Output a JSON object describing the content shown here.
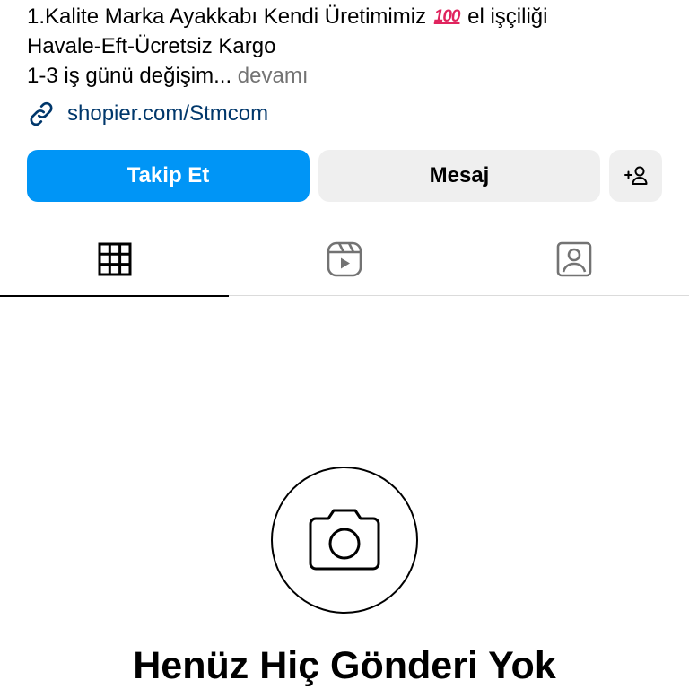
{
  "bio": {
    "line1_before": "1.Kalite Marka Ayakkabı Kendi Üretimimiz",
    "line1_emoji": "100",
    "line1_after": "el işçiliği",
    "line2": "Havale-Eft-Ücretsiz Kargo",
    "line3": "1-3 iş günü değişim...",
    "more": "devamı"
  },
  "link": {
    "icon": "link-icon",
    "text": "shopier.com/Stmcom"
  },
  "actions": {
    "follow_label": "Takip Et",
    "message_label": "Mesaj",
    "suggest_icon": "add-person-icon"
  },
  "tabs": [
    {
      "icon": "grid-icon",
      "active": true
    },
    {
      "icon": "reels-icon",
      "active": false
    },
    {
      "icon": "tagged-icon",
      "active": false
    }
  ],
  "empty_state": {
    "icon": "camera-icon",
    "title": "Henüz Hiç Gönderi Yok"
  },
  "colors": {
    "primary_button": "#0095f6",
    "secondary_button": "#efefef",
    "link": "#00376b",
    "muted": "#737373",
    "emoji_100": "#e0245e"
  }
}
